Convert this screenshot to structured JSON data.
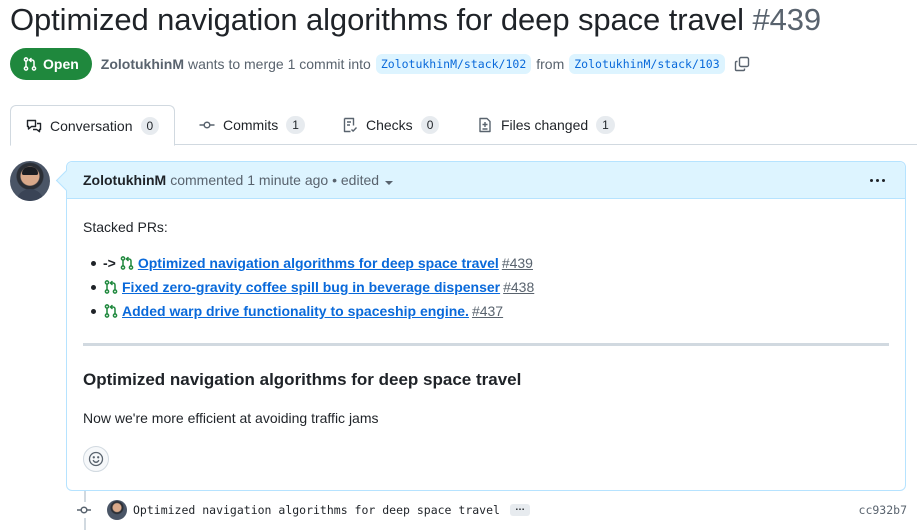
{
  "pr": {
    "title": "Optimized navigation algorithms for deep space travel",
    "number": "#439",
    "status": "Open",
    "author": "ZolotukhinM",
    "merge_text": "wants to merge 1 commit into",
    "base_branch": "ZolotukhinM/stack/102",
    "from_text": "from",
    "head_branch": "ZolotukhinM/stack/103"
  },
  "tabs": [
    {
      "label": "Conversation",
      "count": "0",
      "icon": "comment-discussion-icon"
    },
    {
      "label": "Commits",
      "count": "1",
      "icon": "git-commit-icon"
    },
    {
      "label": "Checks",
      "count": "0",
      "icon": "checklist-icon"
    },
    {
      "label": "Files changed",
      "count": "1",
      "icon": "file-diff-icon"
    }
  ],
  "comment": {
    "author": "ZolotukhinM",
    "action": "commented",
    "time": "1 minute ago",
    "separator": "•",
    "edited": "edited",
    "intro": "Stacked PRs:",
    "stack": [
      {
        "prefix": "->",
        "title": "Optimized navigation algorithms for deep space travel",
        "number": "#439"
      },
      {
        "prefix": "",
        "title": "Fixed zero-gravity coffee spill bug in beverage dispenser",
        "number": "#438"
      },
      {
        "prefix": "",
        "title": "Added warp drive functionality to spaceship engine.",
        "number": "#437"
      }
    ],
    "heading": "Optimized navigation algorithms for deep space travel",
    "description": "Now we're more efficient at avoiding traffic jams"
  },
  "commit": {
    "message": "Optimized navigation algorithms for deep space travel",
    "more": "…",
    "sha": "cc932b7"
  },
  "colors": {
    "open_green": "#1f883d",
    "link_blue": "#0969da",
    "header_bg": "#ddf4ff",
    "muted": "#59636e"
  }
}
